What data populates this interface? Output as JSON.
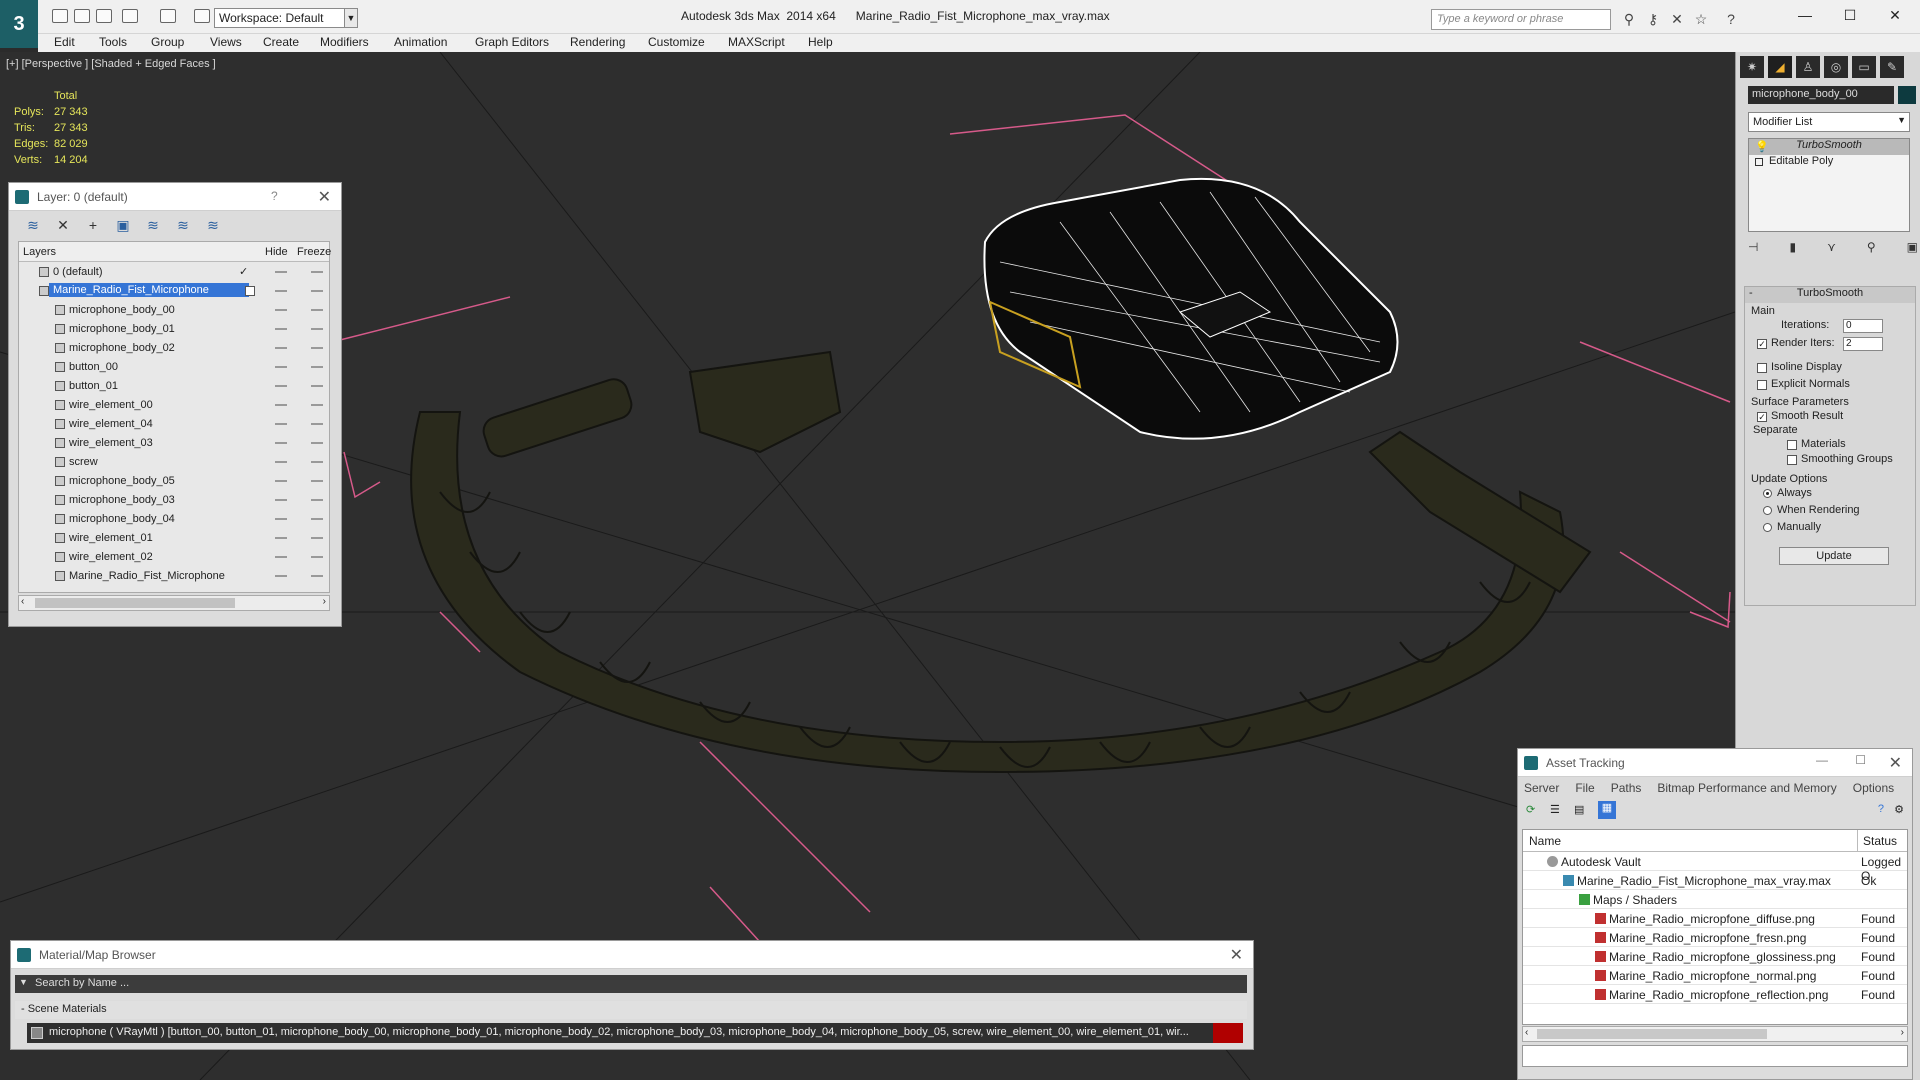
{
  "app": {
    "title": "Autodesk 3ds Max  2014 x64      Marine_Radio_Fist_Microphone_max_vray.max",
    "workspace": "Workspace: Default",
    "search_placeholder": "Type a keyword or phrase"
  },
  "menu": [
    "Edit",
    "Tools",
    "Group",
    "Views",
    "Create",
    "Modifiers",
    "Animation",
    "Graph Editors",
    "Rendering",
    "Customize",
    "MAXScript",
    "Help"
  ],
  "viewport": {
    "label": "[+] [Perspective ] [Shaded + Edged Faces ]",
    "stats_header": "Total",
    "stats": [
      {
        "k": "Polys:",
        "v": "27 343"
      },
      {
        "k": "Tris:",
        "v": "27 343"
      },
      {
        "k": "Edges:",
        "v": "82 029"
      },
      {
        "k": "Verts:",
        "v": "14 204"
      }
    ]
  },
  "layer_panel": {
    "title": "Layer: 0 (default)",
    "help": "?",
    "col_layers": "Layers",
    "col_hide": "Hide",
    "col_freeze": "Freeze",
    "rows": [
      "0 (default)",
      "Marine_Radio_Fist_Microphone",
      "microphone_body_00",
      "microphone_body_01",
      "microphone_body_02",
      "button_00",
      "button_01",
      "wire_element_00",
      "wire_element_04",
      "wire_element_03",
      "screw",
      "microphone_body_05",
      "microphone_body_03",
      "microphone_body_04",
      "wire_element_01",
      "wire_element_02",
      "Marine_Radio_Fist_Microphone"
    ]
  },
  "command_panel": {
    "object_name": "microphone_body_00",
    "modifier_list": "Modifier List",
    "stack": [
      "TurboSmooth",
      "Editable Poly"
    ],
    "rollout_title": "TurboSmooth",
    "main": "Main",
    "iterations_label": "Iterations:",
    "iterations_value": "0",
    "render_iters_label": "Render Iters:",
    "render_iters_value": "2",
    "isoline": "Isoline Display",
    "explicit": "Explicit Normals",
    "surface_params": "Surface Parameters",
    "smooth_result": "Smooth Result",
    "separate": "Separate",
    "materials": "Materials",
    "smoothing_groups": "Smoothing Groups",
    "update_options": "Update Options",
    "always": "Always",
    "when_rendering": "When Rendering",
    "manually": "Manually",
    "update": "Update"
  },
  "asset_panel": {
    "title": "Asset Tracking",
    "menu": [
      "Server",
      "File",
      "Paths",
      "Bitmap Performance and Memory",
      "Options"
    ],
    "col_name": "Name",
    "col_status": "Status",
    "rows": [
      {
        "name": "Autodesk Vault",
        "status": "Logged O"
      },
      {
        "name": "Marine_Radio_Fist_Microphone_max_vray.max",
        "status": "Ok"
      },
      {
        "name": "Maps / Shaders",
        "status": ""
      },
      {
        "name": "Marine_Radio_micropfone_diffuse.png",
        "status": "Found"
      },
      {
        "name": "Marine_Radio_micropfone_fresn.png",
        "status": "Found"
      },
      {
        "name": "Marine_Radio_micropfone_glossiness.png",
        "status": "Found"
      },
      {
        "name": "Marine_Radio_micropfone_normal.png",
        "status": "Found"
      },
      {
        "name": "Marine_Radio_micropfone_reflection.png",
        "status": "Found"
      }
    ]
  },
  "material_panel": {
    "title": "Material/Map Browser",
    "search_placeholder": "Search by Name ...",
    "group": "- Scene Materials",
    "item": "microphone ( VRayMtl ) [button_00, button_01, microphone_body_00, microphone_body_01, microphone_body_02, microphone_body_03, microphone_body_04, microphone_body_05, screw, wire_element_00, wire_element_01, wir..."
  }
}
